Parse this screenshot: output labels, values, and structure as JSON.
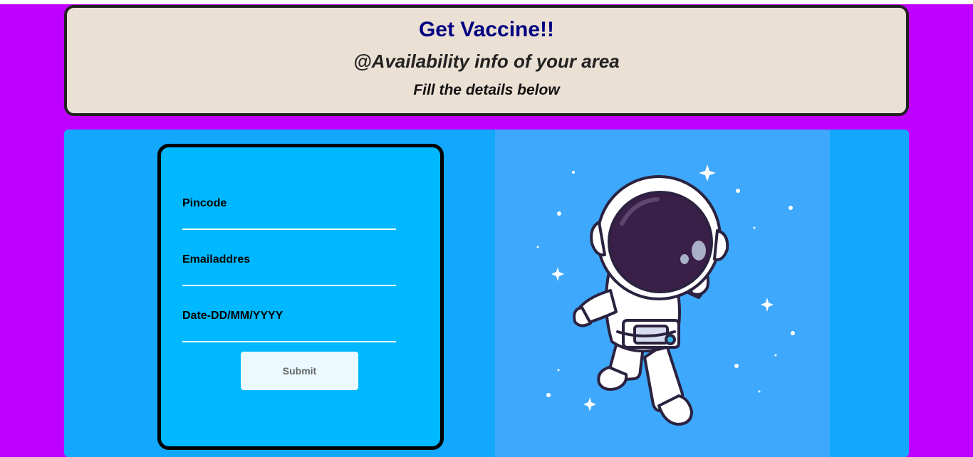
{
  "header": {
    "title": "Get Vaccine!!",
    "subtitle": "@Availability info of your area",
    "instruction": "Fill the details below"
  },
  "form": {
    "fields": [
      {
        "label": "Pincode",
        "value": ""
      },
      {
        "label": "Emailaddres",
        "value": ""
      },
      {
        "label": "Date-DD/MM/YYYY",
        "value": ""
      }
    ],
    "submit_label": "Submit"
  },
  "illustration": {
    "icon": "astronaut-icon"
  },
  "colors": {
    "page_background": "#c000ff",
    "header_background": "#ebe0d4",
    "title": "#000080",
    "panel": "#13a8fb",
    "form_card": "#00b8ff",
    "illustration_background": "#3ea8fc"
  }
}
